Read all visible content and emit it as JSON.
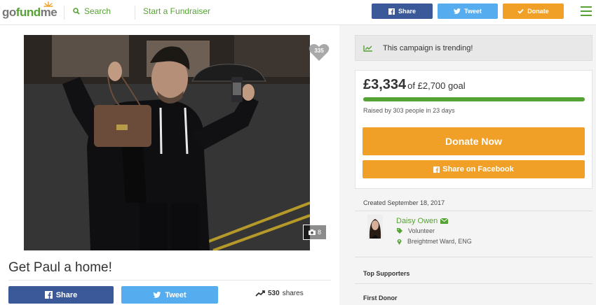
{
  "header": {
    "logo": {
      "go": "go",
      "fund": "fund",
      "me": "me"
    },
    "search_label": "Search",
    "start_label": "Start a Fundraiser",
    "share_label": "Share",
    "tweet_label": "Tweet",
    "donate_label": "Donate"
  },
  "campaign": {
    "hearts": "335",
    "photos": "8",
    "title": "Get Paul a home!",
    "share_label": "Share",
    "tweet_label": "Tweet",
    "shares_count": "530",
    "shares_label": "shares"
  },
  "sidebar": {
    "trending": "This campaign is trending!",
    "raised": "£3,334",
    "goal": "of £2,700 goal",
    "progress": 1.0,
    "raised_by": "Raised by 303 people in 23 days",
    "donate_now": "Donate Now",
    "share_facebook": "Share on Facebook",
    "created": "Created September 18, 2017",
    "organizer": {
      "name": "Daisy Owen",
      "role": "Volunteer",
      "location": "Breightmet Ward, ENG"
    },
    "top_supporters": "Top Supporters",
    "first_donor": "First Donor"
  },
  "colors": {
    "brand_green": "#56a335",
    "facebook": "#3b5998",
    "twitter": "#55acee",
    "donate_orange": "#f0a027"
  }
}
